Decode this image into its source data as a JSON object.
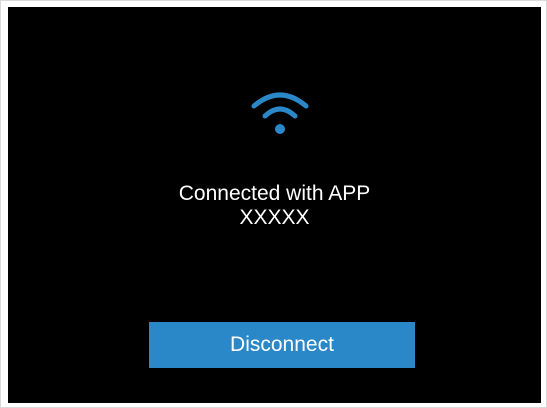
{
  "status": {
    "line1": "Connected with APP",
    "line2": "XXXXX",
    "icon": "wifi-icon"
  },
  "actions": {
    "disconnect_label": "Disconnect"
  },
  "colors": {
    "screen_background": "#000000",
    "accent": "#2a88c8",
    "text": "#ffffff"
  }
}
